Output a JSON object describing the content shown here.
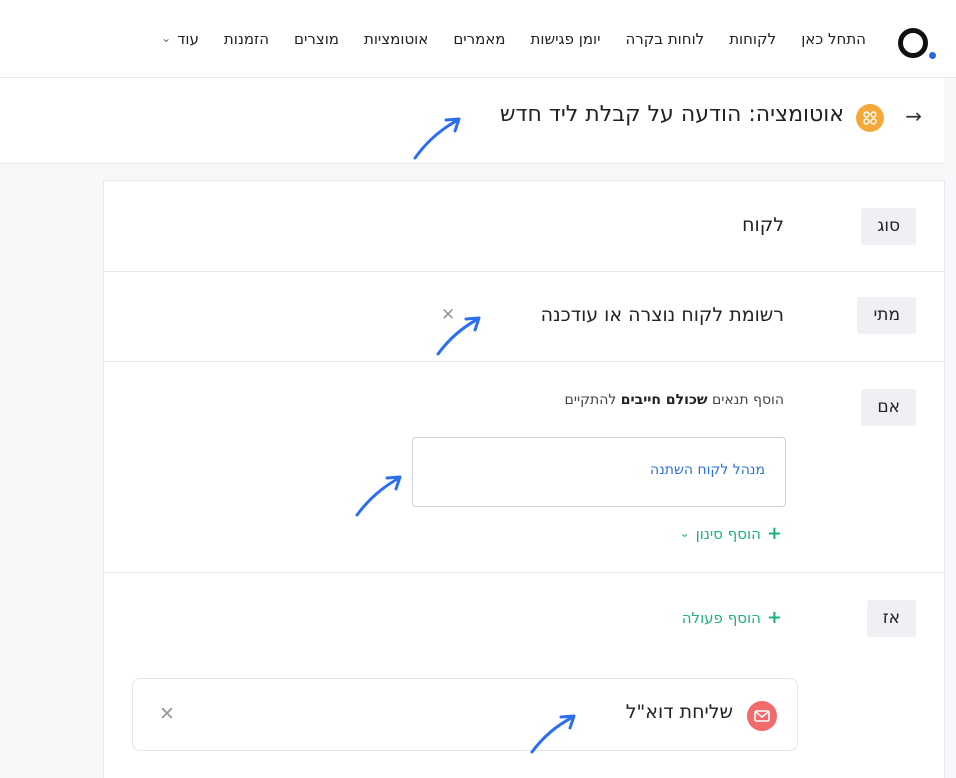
{
  "nav": {
    "items": [
      "התחל כאן",
      "לקוחות",
      "לוחות בקרה",
      "יומן פגישות",
      "מאמרים",
      "אוטומציות",
      "מוצרים",
      "הזמנות"
    ],
    "more_label": "עוד"
  },
  "header": {
    "back_icon": "arrow-right-icon",
    "automation_icon": "automation-icon",
    "title": "אוטומציה: הודעה על קבלת ליד חדש"
  },
  "rows": {
    "type": {
      "tag": "סוג",
      "value": "לקוח"
    },
    "when": {
      "tag": "מתי",
      "value": "רשומת לקוח נוצרה או עודכנה"
    },
    "if": {
      "tag": "אם",
      "hint_prefix": "הוסף תנאים",
      "hint_bold": "שכולם חייבים",
      "hint_suffix": "להתקיים",
      "filter": "מנהל לקוח השתנה",
      "add_filter": "הוסף סינון"
    },
    "then": {
      "tag": "אז",
      "add_action": "הוסף פעולה",
      "action_label": "שליחת דוא\"ל"
    }
  },
  "colors": {
    "accent_green": "#19b382",
    "link_blue": "#2d6fd8",
    "badge_orange": "#f6a93b",
    "email_red": "#f26b6b",
    "annotation_blue": "#2b6ff0"
  }
}
